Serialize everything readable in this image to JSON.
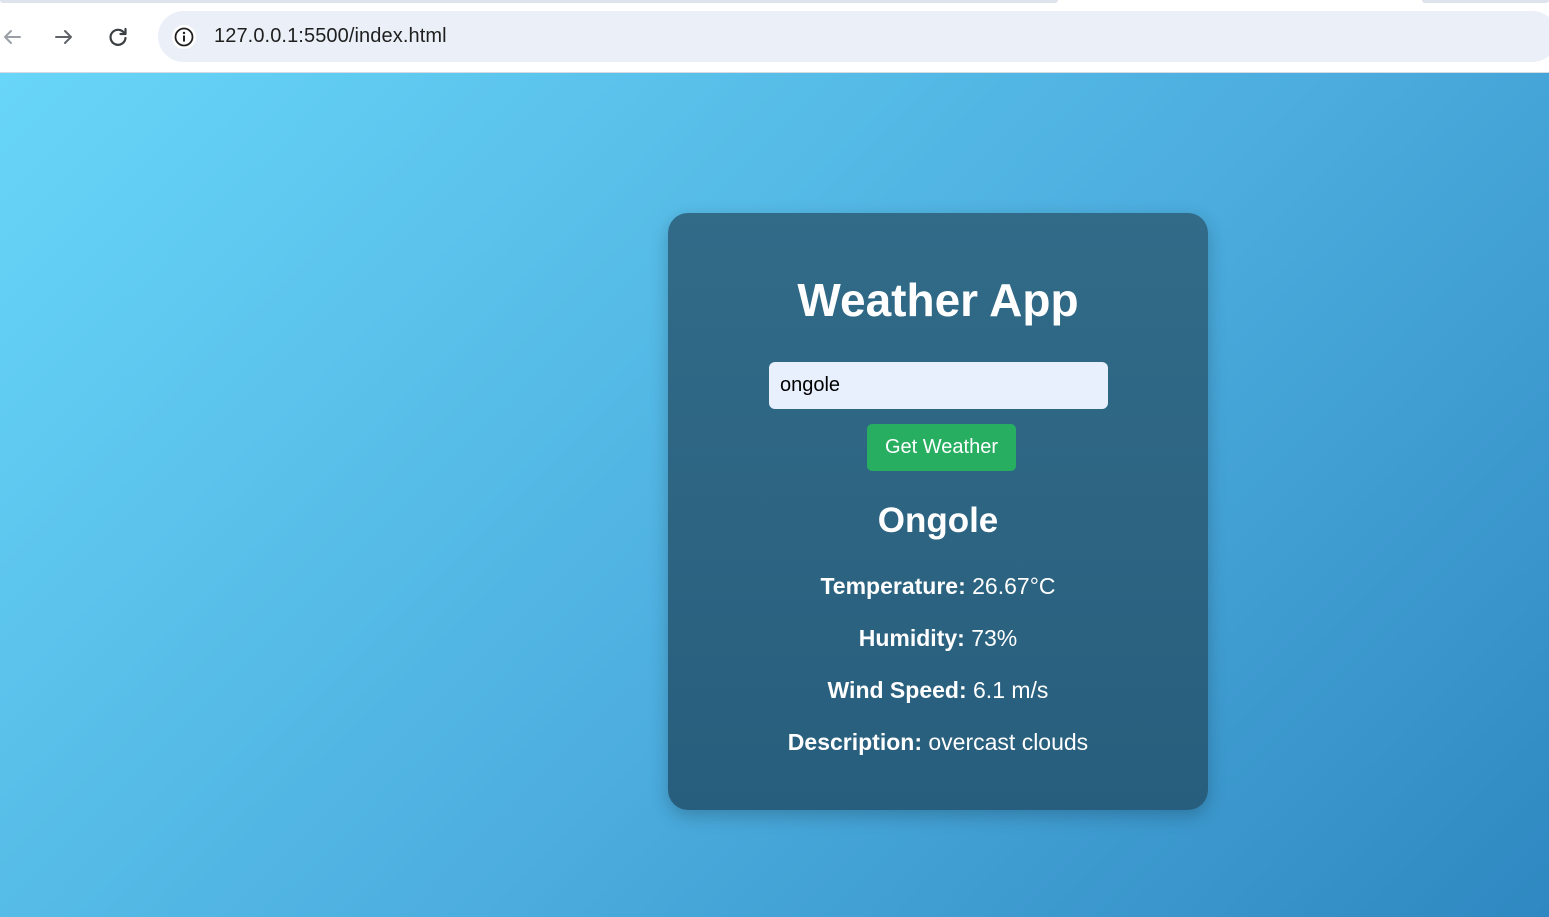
{
  "browser": {
    "url": "127.0.0.1:5500/index.html",
    "icons": {
      "back": "arrow-left-icon",
      "forward": "arrow-right-icon",
      "reload": "reload-icon",
      "site_info": "info-icon"
    }
  },
  "app": {
    "title": "Weather App",
    "search": {
      "value": "ongole"
    },
    "button_label": "Get Weather",
    "city": "Ongole",
    "details": {
      "temperature_label": "Temperature:",
      "temperature_value": "26.67°C",
      "humidity_label": "Humidity:",
      "humidity_value": "73%",
      "wind_label": "Wind Speed:",
      "wind_value": "6.1 m/s",
      "description_label": "Description:",
      "description_value": "overcast clouds"
    }
  },
  "colors": {
    "button": "#27ae60",
    "card": "#2d6b8a",
    "gradient_start": "#68d6f8",
    "gradient_end": "#2f88c1"
  }
}
